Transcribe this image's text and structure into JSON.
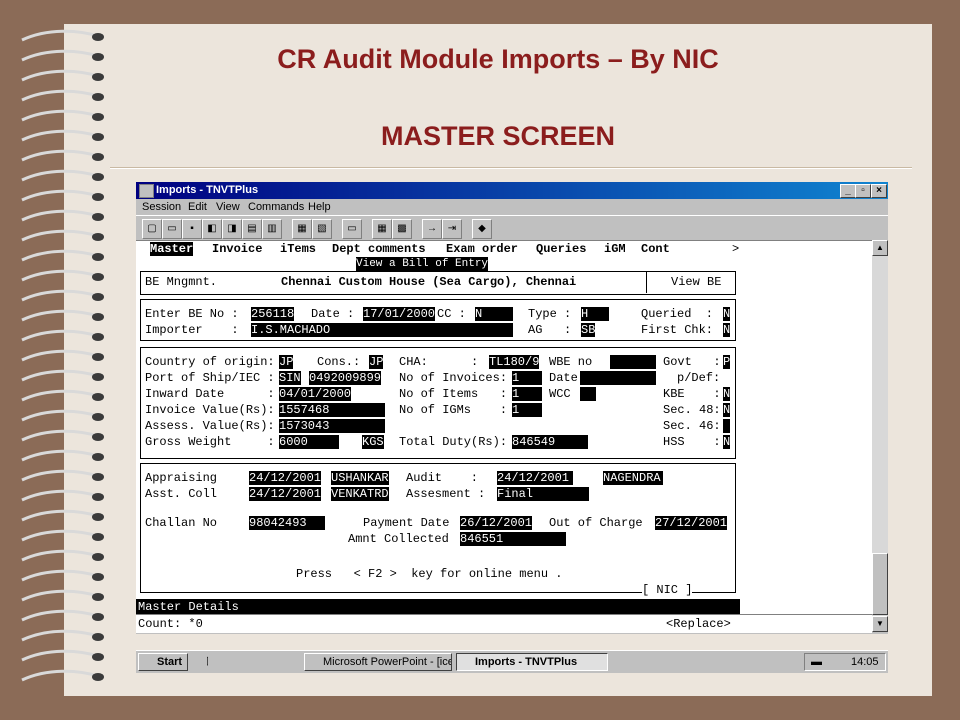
{
  "slide": {
    "title": "CR Audit Module  Imports – By  NIC",
    "subtitle": "MASTER SCREEN"
  },
  "window": {
    "title": "Imports - TNVTPlus",
    "menu": [
      "Session",
      "Edit",
      "View",
      "Commands",
      "Help"
    ]
  },
  "terminal": {
    "tabs": [
      "Master",
      "Invoice",
      "iTems",
      "Dept comments",
      "Exam order",
      "Queries",
      "iGM",
      "Cont",
      ">"
    ],
    "tooltip": "View a Bill of Entry",
    "header_left": "BE Mngmnt.",
    "header_center": "Chennai Custom House (Sea Cargo), Chennai",
    "header_right": "View BE",
    "be_label": "Enter BE No :",
    "be_no": "256118",
    "date_label": "Date :",
    "date": "17/01/2000",
    "cc_label": "CC :",
    "cc": "N",
    "type_label": "Type :",
    "type": "H",
    "queried_label": "Queried  :",
    "queried": "N",
    "importer_label": "Importer    :",
    "importer": "I.S.MACHADO",
    "ag_label": "AG   :",
    "ag": "SB",
    "firstchk_label": "First Chk:",
    "firstchk": "N",
    "country_label": "Country of origin:",
    "country": "JP",
    "cons_label": "Cons.:",
    "cons": "JP",
    "cha_label": "CHA:      :",
    "cha": "TL180/9",
    "wbe_label": "WBE no",
    "govt_label": "Govt   :",
    "govt": "P",
    "port_label": "Port of Ship/IEC :",
    "port": "SIN",
    "iec": "0492009899",
    "noinv_label": "No of Invoices:",
    "noinv": "1",
    "date2_label": "Date",
    "pdef_label": "p/Def:",
    "inward_label": "Inward Date      :",
    "inward": "04/01/2000",
    "noitems_label": "No of Items   :",
    "noitems": "1",
    "wcc_label": "WCC",
    "kbe_label": "KBE    :",
    "kbe": "N",
    "invval_label": "Invoice Value(Rs):",
    "invval": "1557468",
    "noigm_label": "No of IGMs    :",
    "noigm": "1",
    "sec48_label": "Sec. 48:",
    "sec48": "N",
    "assess_label": "Assess. Value(Rs):",
    "assess": "1573043",
    "sec46_label": "Sec. 46:",
    "gross_label": "Gross Weight     :",
    "gross": "6000",
    "kgs": "KGS",
    "duty_label": "Total Duty(Rs):",
    "duty": "846549",
    "hss_label": "HSS    :",
    "hss": "N",
    "appr_label": "Appraising",
    "appr_date": "24/12/2001",
    "appr_name": "USHANKAR",
    "audit_label": "Audit    :",
    "audit_date": "24/12/2001",
    "audit_name": "NAGENDRA",
    "asst_label": "Asst. Coll",
    "asst_date": "24/12/2001",
    "asst_name": "VENKATRD",
    "assesment_label": "Assesment :",
    "assesment": "Final",
    "challan_label": "Challan No",
    "challan": "98042493",
    "paydate_label": "Payment Date",
    "paydate": "26/12/2001",
    "ooc_label": "Out of Charge",
    "ooc": "27/12/2001",
    "amnt_label": "Amnt Collected",
    "amnt": "846551",
    "press_hint": "Press   < F2 >  key for online menu .",
    "nic_tag": "[ NIC ]",
    "status": "Master Details",
    "count": "Count: *0",
    "replace": "<Replace>"
  },
  "taskbar": {
    "start": "Start",
    "tasks": [
      "Microsoft PowerPoint - [ice...",
      "Imports - TNVTPlus"
    ],
    "clock": "14:05"
  }
}
